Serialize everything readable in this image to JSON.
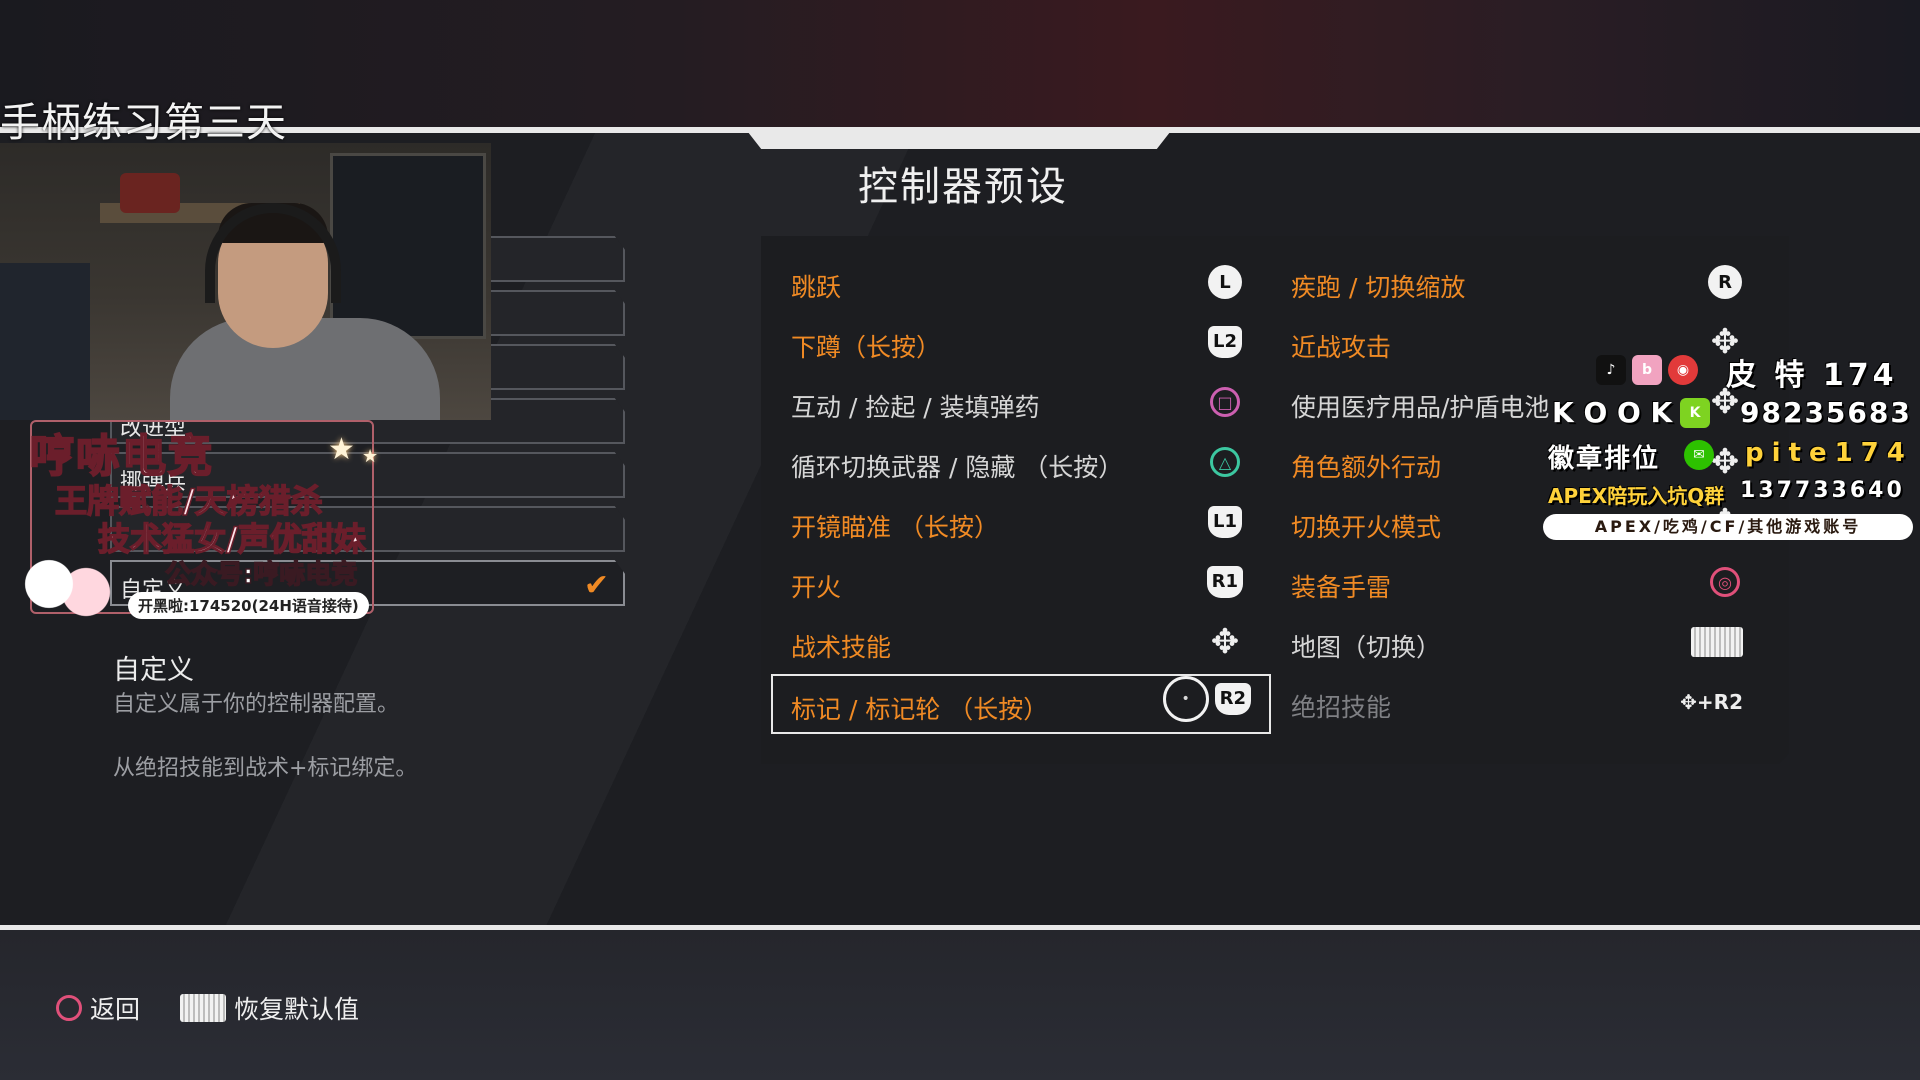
{
  "stream_title": "手柄练习第三天",
  "screen_title": "控制器预设",
  "presets": [
    {
      "label": "",
      "selected": false
    },
    {
      "label": "",
      "selected": false
    },
    {
      "label": "",
      "selected": false
    },
    {
      "label": "改进型",
      "selected": false
    },
    {
      "label": "挪弹兵",
      "selected": false
    },
    {
      "label": "",
      "selected": false
    },
    {
      "label": "自定义",
      "selected": true
    }
  ],
  "description": {
    "title": "自定义",
    "line1": "自定义属于你的控制器配置。",
    "line2": "从绝招技能到战术+标记绑定。"
  },
  "bindings_left": [
    {
      "label": "跳跃",
      "icon": "L-stick-press",
      "icon_text": "L",
      "style": "orange"
    },
    {
      "label": "下蹲（长按）",
      "icon": "L2-button",
      "icon_text": "L2",
      "style": "orange"
    },
    {
      "label": "互动 / 捡起 / 装填弹药",
      "icon": "square-button",
      "icon_text": "□",
      "style": "grey"
    },
    {
      "label": "循环切换武器 / 隐藏 （长按）",
      "icon": "triangle-button",
      "icon_text": "△",
      "style": "grey"
    },
    {
      "label": "开镜瞄准 （长按）",
      "icon": "L1-button",
      "icon_text": "L1",
      "style": "orange"
    },
    {
      "label": "开火",
      "icon": "R1-button",
      "icon_text": "R1",
      "style": "orange"
    },
    {
      "label": "战术技能",
      "icon": "dpad-icon",
      "icon_text": "✥",
      "style": "orange"
    },
    {
      "label": "标记 / 标记轮 （长按）",
      "icon": "R2-button",
      "icon_text": "R2",
      "style": "orange",
      "focused": true
    }
  ],
  "bindings_right": [
    {
      "label": "疾跑 / 切换缩放",
      "icon": "R-stick-press",
      "icon_text": "R",
      "style": "orange"
    },
    {
      "label": "近战攻击",
      "icon": "dpad-icon",
      "icon_text": "✥",
      "style": "orange"
    },
    {
      "label": "使用医疗用品/护盾电池",
      "icon": "dpad-icon",
      "icon_text": "✥",
      "style": "grey"
    },
    {
      "label": "角色额外行动",
      "icon": "dpad-icon",
      "icon_text": "✥",
      "style": "orange"
    },
    {
      "label": "切换开火模式",
      "icon": "dpad-icon",
      "icon_text": "✥",
      "style": "orange"
    },
    {
      "label": "装备手雷",
      "icon": "circle-button",
      "icon_text": "◎",
      "style": "orange"
    },
    {
      "label": "地图（切换）",
      "icon": "touchpad-icon",
      "icon_text": "",
      "style": "grey"
    },
    {
      "label": "绝招技能",
      "icon": "dpad-plus-R2-icon",
      "icon_text": "✥+R2",
      "style": "dim"
    }
  ],
  "overlay_left": {
    "brand": "哼哧电竞",
    "line1": "王牌赋能/天榜猎杀",
    "line2": "技术猛女/声优甜妹",
    "line3": "公众号:哼哧电竞",
    "line4": "开黑啦:174520(24H语音接待)"
  },
  "overlay_right": {
    "social_name": "皮 特 174",
    "kook_label": "K O O K",
    "kook_value": "98235683",
    "rank_label": "徽章排位",
    "rank_value": "pite174",
    "apex_label": "APEX陪玩入坑Q群",
    "apex_value": "137733640",
    "pill": "APEX/吃鸡/CF/其他游戏账号",
    "icons": [
      "tiktok-icon",
      "bilibili-icon",
      "weibo-icon"
    ]
  },
  "footer": {
    "back_label": "返回",
    "reset_label": "恢复默认值"
  },
  "colors": {
    "accent": "#f08a24",
    "text_grey": "#d6d6d6",
    "panel_bg": "#1c1d20"
  }
}
